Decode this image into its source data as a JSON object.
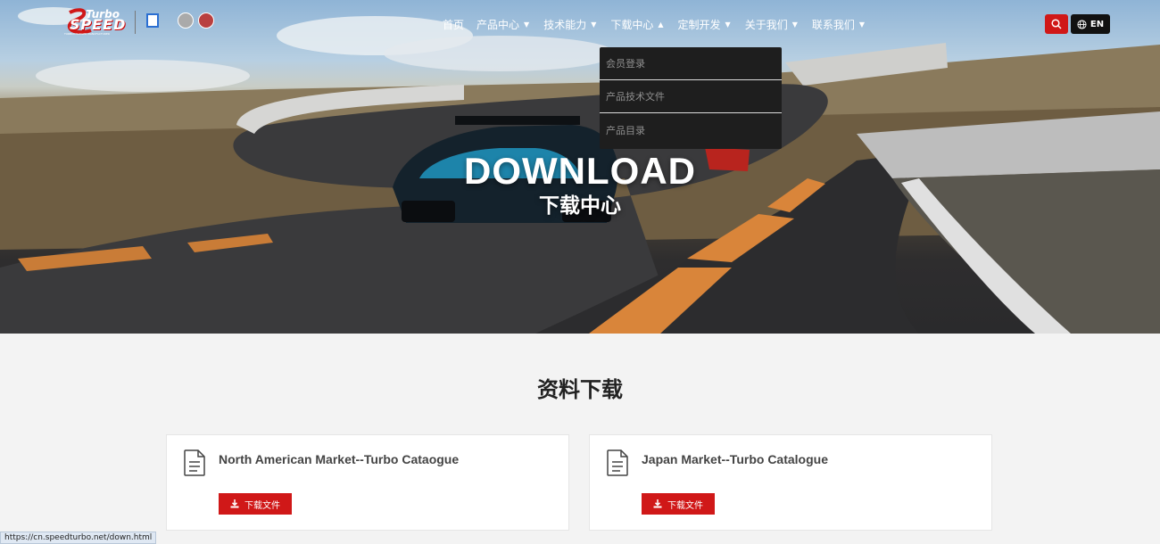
{
  "header": {
    "logo_turbo": "Turbo",
    "logo_speed": "SPEED",
    "logo_tagline": "TURBOCHARGER MANUFACTURER",
    "nav": [
      {
        "label": "首页",
        "has_arrow": false
      },
      {
        "label": "产品中心",
        "arrow": "▼"
      },
      {
        "label": "技术能力",
        "arrow": "▼"
      },
      {
        "label": "下载中心",
        "arrow": "▲"
      },
      {
        "label": "定制开发",
        "arrow": "▼"
      },
      {
        "label": "关于我们",
        "arrow": "▼"
      },
      {
        "label": "联系我们",
        "arrow": "▼"
      }
    ],
    "lang_label": "EN"
  },
  "dropdown": {
    "items": [
      "会员登录",
      "产品技术文件",
      "产品目录"
    ]
  },
  "hero": {
    "title": "DOWNLOAD",
    "subtitle": "下载中心"
  },
  "main": {
    "section_title": "资料下载",
    "cards": [
      {
        "title": "North American Market--Turbo Cataogue",
        "button_label": "下载文件"
      },
      {
        "title": "Japan Market--Turbo Catalogue",
        "button_label": "下载文件"
      }
    ]
  },
  "status_bar": {
    "url": "https://cn.speedturbo.net/down.html"
  },
  "colors": {
    "accent_red": "#d01818",
    "dropdown_bg": "#1e1e1e",
    "page_bg": "#f3f3f3"
  }
}
